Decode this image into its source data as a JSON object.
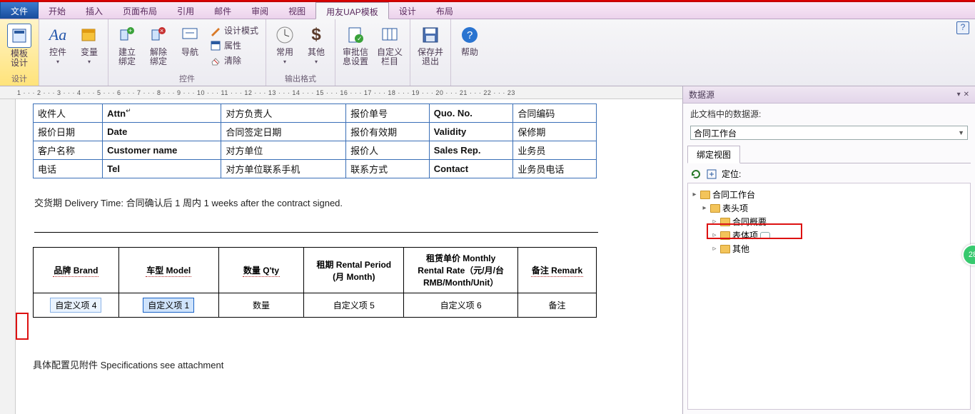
{
  "menu": {
    "file": "文件",
    "tabs": [
      "开始",
      "插入",
      "页面布局",
      "引用",
      "邮件",
      "审阅",
      "视图",
      "用友UAP模板",
      "设计",
      "布局"
    ],
    "active_index": 7
  },
  "ribbon": {
    "g1": {
      "label": "设计",
      "btn": "模板\n设计"
    },
    "g2": {
      "label": "",
      "btns": [
        "控件",
        "变量"
      ]
    },
    "g3": {
      "label": "控件",
      "btns": [
        "建立\n绑定",
        "解除\n绑定",
        "导航"
      ],
      "small": [
        "设计模式",
        "属性",
        "清除"
      ]
    },
    "g4": {
      "label": "输出格式",
      "btns": [
        "常用",
        "其他"
      ]
    },
    "g5": {
      "label": "",
      "btns": [
        "审批信\n息设置",
        "自定义\n栏目"
      ]
    },
    "g6": {
      "label": "",
      "btns": [
        "保存并\n退出"
      ]
    },
    "g7": {
      "label": "",
      "btns": [
        "帮助"
      ]
    },
    "dollar": "$"
  },
  "ruler": " 1 · · · 2 · · · 3 · · · 4 · · · 5 · · · 6 · · · 7 · · · 8 · · · 9 · · · 10 · · · 11 · · · 12 · · · 13 · · · 14 · · · 15 · · · 16 · · · 17 · · · 18 · · · 19 · · · 20 · · · 21 · · · 22 · · · 23",
  "form_rows": [
    [
      "收件人",
      "Attn",
      "对方负责人",
      "报价单号",
      "Quo. No.",
      "合同编码"
    ],
    [
      "报价日期",
      "Date",
      "合同签定日期",
      "报价有效期",
      "Validity",
      "保修期"
    ],
    [
      "客户名称",
      "Customer name",
      "对方单位",
      "报价人",
      "Sales Rep.",
      "业务员"
    ],
    [
      "电话",
      "Tel",
      "对方单位联系手机",
      "联系方式",
      "Contact",
      "业务员电话"
    ]
  ],
  "delivery": {
    "prefix": "交货期 Delivery Time: 合同确认后  1  周内     1     weeks after the contract signed."
  },
  "items": {
    "headers": [
      "品牌 Brand",
      "车型 Model",
      "数量 Q'ty",
      "租期 Rental Period\n(月 Month)",
      "租赁单价 Monthly\nRental Rate（元/月/台\nRMB/Month/Unit）",
      "备注 Remark"
    ],
    "row": [
      "自定义项 4",
      "自定义项 1",
      "数量",
      "自定义项 5",
      "自定义项 6",
      "备注"
    ]
  },
  "attach": "具体配置见附件  Specifications see attachment",
  "ds": {
    "title": "数据源",
    "subtitle": "此文档中的数据源:",
    "combo": "合同工作台",
    "tab": "绑定视图",
    "locate": "定位:",
    "tree": {
      "root": "合同工作台",
      "n1": "表头项",
      "n2": "合同概要",
      "n3": "表体项",
      "n4": "其他"
    }
  },
  "badge": "28"
}
